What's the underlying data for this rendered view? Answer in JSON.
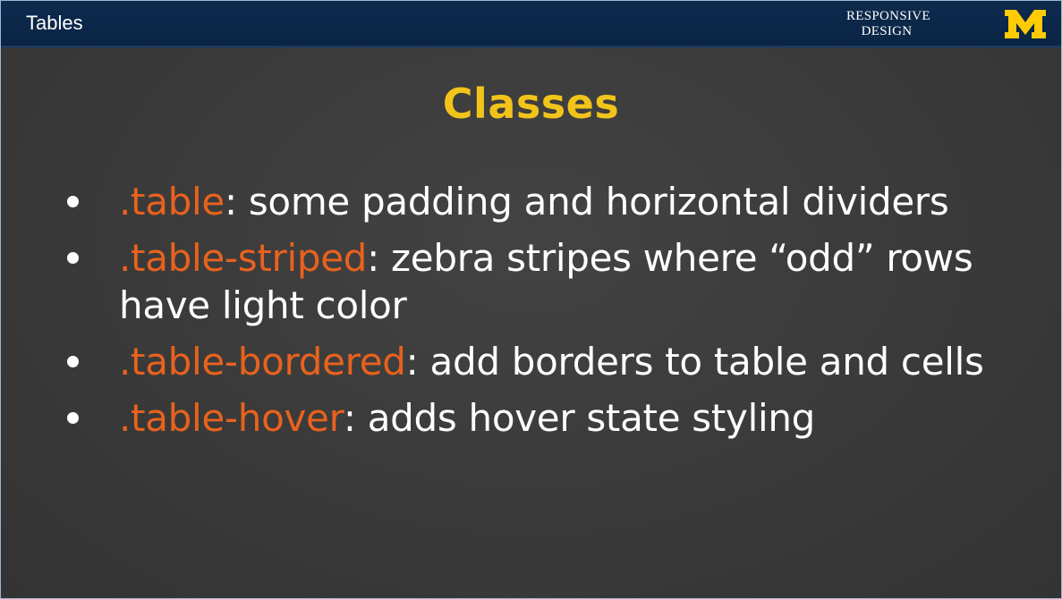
{
  "header": {
    "title": "Tables",
    "brand_line1": "RESPONSIVE",
    "brand_line2": "DESIGN",
    "logo_letter": "M"
  },
  "slide": {
    "heading": "Classes",
    "bullets": [
      {
        "code": ".table",
        "text": ": some padding and horizontal dividers"
      },
      {
        "code": ".table-striped",
        "text": ": zebra stripes where “odd” rows have light color"
      },
      {
        "code": ".table-bordered",
        "text": ": add borders to table and cells"
      },
      {
        "code": ".table-hover",
        "text": ": adds hover state styling"
      }
    ]
  },
  "colors": {
    "header_bg": "#0b2647",
    "slide_bg": "#3b3b3b",
    "heading": "#f2c41a",
    "code": "#e8621d",
    "text": "#ffffff",
    "logo": "#ffcb05"
  }
}
